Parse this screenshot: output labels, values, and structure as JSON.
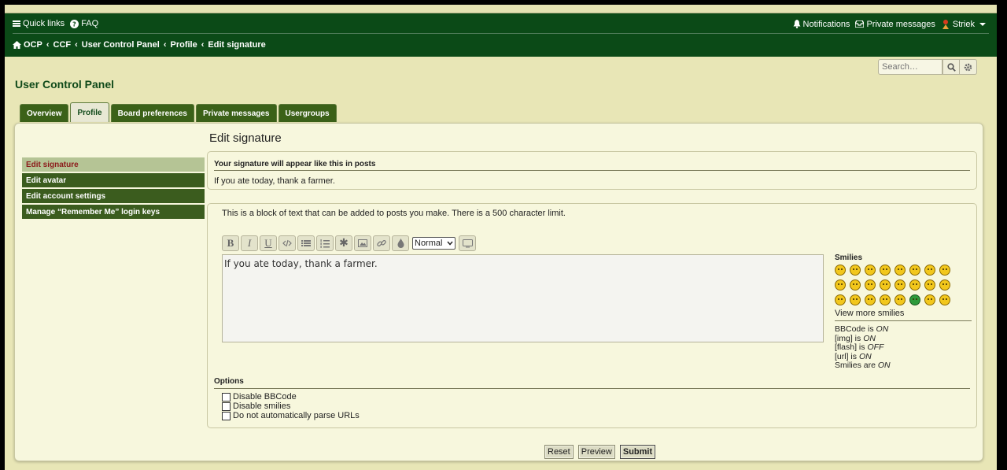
{
  "header": {
    "quick_links": "Quick links",
    "faq": "FAQ",
    "notifications": "Notifications",
    "private_messages": "Private messages",
    "username": "Striek"
  },
  "breadcrumbs": [
    "OCP",
    "CCF",
    "User Control Panel",
    "Profile",
    "Edit signature"
  ],
  "search": {
    "placeholder": "Search…"
  },
  "page_title": "User Control Panel",
  "tabs": [
    {
      "label": "Overview"
    },
    {
      "label": "Profile",
      "active": true
    },
    {
      "label": "Board preferences"
    },
    {
      "label": "Private messages"
    },
    {
      "label": "Usergroups"
    }
  ],
  "sidebar": [
    {
      "label": "Edit signature",
      "active": true
    },
    {
      "label": "Edit avatar"
    },
    {
      "label": "Edit account settings"
    },
    {
      "label": "Manage “Remember Me” login keys"
    }
  ],
  "main": {
    "heading": "Edit signature",
    "preview_heading": "Your signature will appear like this in posts",
    "preview_text": "If you ate today, thank a farmer.",
    "description": "This is a block of text that can be added to posts you make. There is a 500 character limit.",
    "font_size_select": "Normal",
    "signature_text": "If you ate today, thank a farmer."
  },
  "smilies": {
    "heading": "Smilies",
    "view_more": "View more smilies",
    "status": {
      "bbcode_label": "BBCode is",
      "bbcode_value": "ON",
      "img_label": "[img] is",
      "img_value": "ON",
      "flash_label": "[flash] is",
      "flash_value": "OFF",
      "url_label": "[url] is",
      "url_value": "ON",
      "smilies_label": "Smilies are",
      "smilies_value": "ON"
    }
  },
  "options": {
    "heading": "Options",
    "disable_bbcode": "Disable BBCode",
    "disable_smilies": "Disable smilies",
    "disable_urls": "Do not automatically parse URLs"
  },
  "buttons": {
    "reset": "Reset",
    "preview": "Preview",
    "submit": "Submit"
  },
  "colors": {
    "header_bg": "#0b4a17",
    "tab_bg": "#3b6118",
    "page_bg": "#e8e6b6",
    "active_side_text": "#8c1a1a"
  }
}
